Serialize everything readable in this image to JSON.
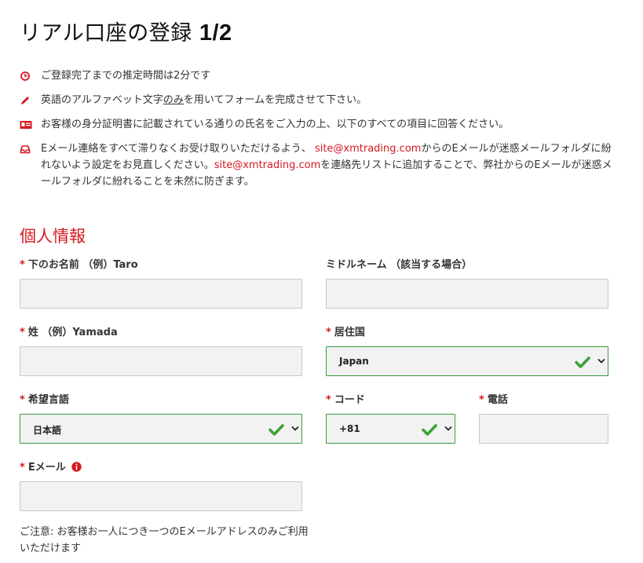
{
  "page": {
    "title_text": "リアル口座の登録 ",
    "title_step": "1/2"
  },
  "notes": {
    "time": "ご登録完了までの推定時間は2分です",
    "alphabet_pre": "英語のアルファベット文字",
    "alphabet_underline": "のみ",
    "alphabet_post": "を用いてフォームを完成させて下さい。",
    "id_doc": "お客様の身分証明書に記載されている通りの氏名をご入力の上、以下のすべての項目に回答ください。",
    "email_1": "Eメール連絡をすべて滞りなくお受け取りいただけるよう、",
    "email_link_1": "site@xmtrading.com",
    "email_2": "からのEメールが迷惑メールフォルダに紛れないよう設定をお見直しください。",
    "email_link_2": "site@xmtrading.com",
    "email_3": "を連絡先リストに追加することで、弊社からのEメールが迷惑メールフォルダに紛れることを未然に防ぎます。"
  },
  "section": {
    "title": "個人情報"
  },
  "form": {
    "required_mark": "*",
    "first_name_label": "下のお名前 （例）Taro",
    "middle_name_label": "ミドルネーム （該当する場合）",
    "last_name_label": "姓 （例）Yamada",
    "country_label": "居住国",
    "country_value": "Japan",
    "language_label": "希望言語",
    "language_value": "日本語",
    "code_label": "コード",
    "code_value": "+81",
    "phone_label": "電話",
    "email_label": "Eメール",
    "email_notice": "ご注意: お客様お一人につき一つのEメールアドレスのみご利用いただけます"
  },
  "colors": {
    "accent_red": "#d51820",
    "valid_green": "#3c9a3c",
    "check_green": "#3aa335"
  },
  "icons": {
    "time": "clock-icon",
    "alphabet": "pencil-icon",
    "id_doc": "id-card-icon",
    "email": "inbox-icon",
    "email_info": "info-icon",
    "valid": "checkmark-icon",
    "select": "chevron-down-icon"
  }
}
